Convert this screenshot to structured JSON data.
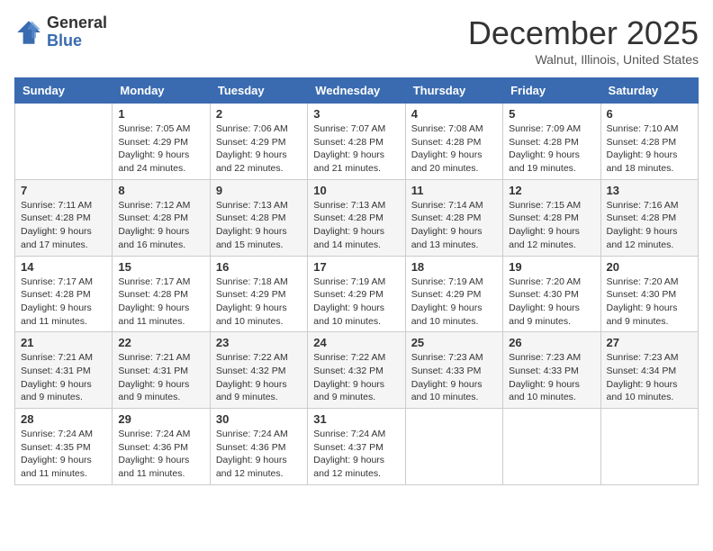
{
  "header": {
    "logo_general": "General",
    "logo_blue": "Blue",
    "month_title": "December 2025",
    "location": "Walnut, Illinois, United States"
  },
  "days_of_week": [
    "Sunday",
    "Monday",
    "Tuesday",
    "Wednesday",
    "Thursday",
    "Friday",
    "Saturday"
  ],
  "weeks": [
    [
      {
        "day": "",
        "info": ""
      },
      {
        "day": "1",
        "info": "Sunrise: 7:05 AM\nSunset: 4:29 PM\nDaylight: 9 hours\nand 24 minutes."
      },
      {
        "day": "2",
        "info": "Sunrise: 7:06 AM\nSunset: 4:29 PM\nDaylight: 9 hours\nand 22 minutes."
      },
      {
        "day": "3",
        "info": "Sunrise: 7:07 AM\nSunset: 4:28 PM\nDaylight: 9 hours\nand 21 minutes."
      },
      {
        "day": "4",
        "info": "Sunrise: 7:08 AM\nSunset: 4:28 PM\nDaylight: 9 hours\nand 20 minutes."
      },
      {
        "day": "5",
        "info": "Sunrise: 7:09 AM\nSunset: 4:28 PM\nDaylight: 9 hours\nand 19 minutes."
      },
      {
        "day": "6",
        "info": "Sunrise: 7:10 AM\nSunset: 4:28 PM\nDaylight: 9 hours\nand 18 minutes."
      }
    ],
    [
      {
        "day": "7",
        "info": "Sunrise: 7:11 AM\nSunset: 4:28 PM\nDaylight: 9 hours\nand 17 minutes."
      },
      {
        "day": "8",
        "info": "Sunrise: 7:12 AM\nSunset: 4:28 PM\nDaylight: 9 hours\nand 16 minutes."
      },
      {
        "day": "9",
        "info": "Sunrise: 7:13 AM\nSunset: 4:28 PM\nDaylight: 9 hours\nand 15 minutes."
      },
      {
        "day": "10",
        "info": "Sunrise: 7:13 AM\nSunset: 4:28 PM\nDaylight: 9 hours\nand 14 minutes."
      },
      {
        "day": "11",
        "info": "Sunrise: 7:14 AM\nSunset: 4:28 PM\nDaylight: 9 hours\nand 13 minutes."
      },
      {
        "day": "12",
        "info": "Sunrise: 7:15 AM\nSunset: 4:28 PM\nDaylight: 9 hours\nand 12 minutes."
      },
      {
        "day": "13",
        "info": "Sunrise: 7:16 AM\nSunset: 4:28 PM\nDaylight: 9 hours\nand 12 minutes."
      }
    ],
    [
      {
        "day": "14",
        "info": "Sunrise: 7:17 AM\nSunset: 4:28 PM\nDaylight: 9 hours\nand 11 minutes."
      },
      {
        "day": "15",
        "info": "Sunrise: 7:17 AM\nSunset: 4:28 PM\nDaylight: 9 hours\nand 11 minutes."
      },
      {
        "day": "16",
        "info": "Sunrise: 7:18 AM\nSunset: 4:29 PM\nDaylight: 9 hours\nand 10 minutes."
      },
      {
        "day": "17",
        "info": "Sunrise: 7:19 AM\nSunset: 4:29 PM\nDaylight: 9 hours\nand 10 minutes."
      },
      {
        "day": "18",
        "info": "Sunrise: 7:19 AM\nSunset: 4:29 PM\nDaylight: 9 hours\nand 10 minutes."
      },
      {
        "day": "19",
        "info": "Sunrise: 7:20 AM\nSunset: 4:30 PM\nDaylight: 9 hours\nand 9 minutes."
      },
      {
        "day": "20",
        "info": "Sunrise: 7:20 AM\nSunset: 4:30 PM\nDaylight: 9 hours\nand 9 minutes."
      }
    ],
    [
      {
        "day": "21",
        "info": "Sunrise: 7:21 AM\nSunset: 4:31 PM\nDaylight: 9 hours\nand 9 minutes."
      },
      {
        "day": "22",
        "info": "Sunrise: 7:21 AM\nSunset: 4:31 PM\nDaylight: 9 hours\nand 9 minutes."
      },
      {
        "day": "23",
        "info": "Sunrise: 7:22 AM\nSunset: 4:32 PM\nDaylight: 9 hours\nand 9 minutes."
      },
      {
        "day": "24",
        "info": "Sunrise: 7:22 AM\nSunset: 4:32 PM\nDaylight: 9 hours\nand 9 minutes."
      },
      {
        "day": "25",
        "info": "Sunrise: 7:23 AM\nSunset: 4:33 PM\nDaylight: 9 hours\nand 10 minutes."
      },
      {
        "day": "26",
        "info": "Sunrise: 7:23 AM\nSunset: 4:33 PM\nDaylight: 9 hours\nand 10 minutes."
      },
      {
        "day": "27",
        "info": "Sunrise: 7:23 AM\nSunset: 4:34 PM\nDaylight: 9 hours\nand 10 minutes."
      }
    ],
    [
      {
        "day": "28",
        "info": "Sunrise: 7:24 AM\nSunset: 4:35 PM\nDaylight: 9 hours\nand 11 minutes."
      },
      {
        "day": "29",
        "info": "Sunrise: 7:24 AM\nSunset: 4:36 PM\nDaylight: 9 hours\nand 11 minutes."
      },
      {
        "day": "30",
        "info": "Sunrise: 7:24 AM\nSunset: 4:36 PM\nDaylight: 9 hours\nand 12 minutes."
      },
      {
        "day": "31",
        "info": "Sunrise: 7:24 AM\nSunset: 4:37 PM\nDaylight: 9 hours\nand 12 minutes."
      },
      {
        "day": "",
        "info": ""
      },
      {
        "day": "",
        "info": ""
      },
      {
        "day": "",
        "info": ""
      }
    ]
  ]
}
